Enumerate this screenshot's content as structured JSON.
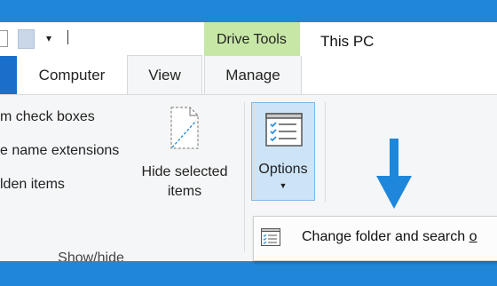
{
  "window": {
    "title": "This PC"
  },
  "ribbon_tabs": {
    "contextual_group": "Drive Tools",
    "computer": "Computer",
    "view": "View",
    "manage": "Manage"
  },
  "show_hide": {
    "item_check_boxes": "m check boxes",
    "file_name_extensions": "e name extensions",
    "hidden_items": "lden items",
    "hide_selected_items": "Hide selected items",
    "group_label": "Show/hide"
  },
  "options": {
    "label": "Options",
    "caret": "▼"
  },
  "dropdown": {
    "item_text": "Change folder and search ",
    "item_underlined": "o"
  },
  "colors": {
    "accent": "#1f86d8",
    "contextual_tab": "#c7e7a6",
    "selected_button": "#cde4f7",
    "arrow": "#1e87db"
  }
}
